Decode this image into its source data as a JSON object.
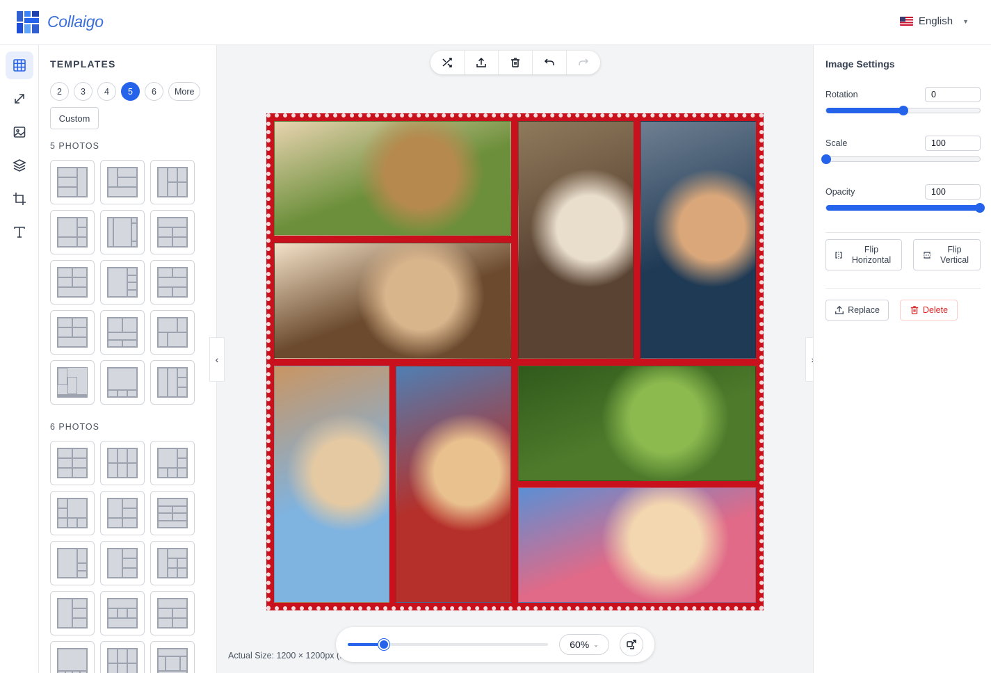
{
  "app": {
    "name": "Collaigo",
    "language": "English"
  },
  "rail": {
    "tools": [
      "grid-icon",
      "expand-icon",
      "image-icon",
      "layers-icon",
      "crop-icon",
      "text-icon"
    ],
    "active": "grid-icon"
  },
  "templates": {
    "title": "TEMPLATES",
    "counts": [
      "2",
      "3",
      "4",
      "5",
      "6",
      "More"
    ],
    "active_count": "5",
    "custom_label": "Custom",
    "section_5": "5 PHOTOS",
    "section_6": "6 PHOTOS"
  },
  "toolbar": {
    "buttons": [
      "shuffle-icon",
      "upload-icon",
      "trash-icon",
      "undo-icon",
      "redo-icon"
    ]
  },
  "collage": {
    "border_color": "#c8111c",
    "photos": [
      {
        "name": "photo-giraffe",
        "colors": [
          "#6b8f3a",
          "#b68a4f",
          "#e8d3b0"
        ]
      },
      {
        "name": "photo-reading",
        "colors": [
          "#6b4a2e",
          "#d9b58c",
          "#f3e2c8"
        ]
      },
      {
        "name": "photo-lamb",
        "colors": [
          "#5a4333",
          "#e9ddcc",
          "#8f7a5c"
        ]
      },
      {
        "name": "photo-portrait",
        "colors": [
          "#1f3a55",
          "#d9a77a",
          "#6f7f91"
        ]
      },
      {
        "name": "photo-beach",
        "colors": [
          "#7fb3e0",
          "#e4c9a3",
          "#c99563"
        ]
      },
      {
        "name": "photo-carousel",
        "colors": [
          "#b5302a",
          "#e9c18f",
          "#4f7fb3"
        ]
      },
      {
        "name": "photo-kite",
        "colors": [
          "#4d7a2b",
          "#8cba4f",
          "#2f5a1c"
        ]
      },
      {
        "name": "photo-birthday",
        "colors": [
          "#e06a88",
          "#f3d7b0",
          "#5b8fd4"
        ]
      }
    ]
  },
  "zoom": {
    "level_label": "60%",
    "level": 0.18,
    "actual_size": "Actual Size: 1200 × 1200px (..."
  },
  "settings": {
    "title": "Image Settings",
    "rotation_label": "Rotation",
    "rotation_value": "0",
    "rotation_level": 0.5,
    "scale_label": "Scale",
    "scale_value": "100",
    "scale_level": 0.0,
    "opacity_label": "Opacity",
    "opacity_value": "100",
    "opacity_level": 1.0,
    "flip_h_label_1": "Flip",
    "flip_h_label_2": "Horizontal",
    "flip_v_label_1": "Flip",
    "flip_v_label_2": "Vertical",
    "replace_label": "Replace",
    "delete_label": "Delete"
  },
  "colors": {
    "accent": "#2563eb",
    "danger": "#dc2626",
    "logo": "#3b6fd9"
  }
}
